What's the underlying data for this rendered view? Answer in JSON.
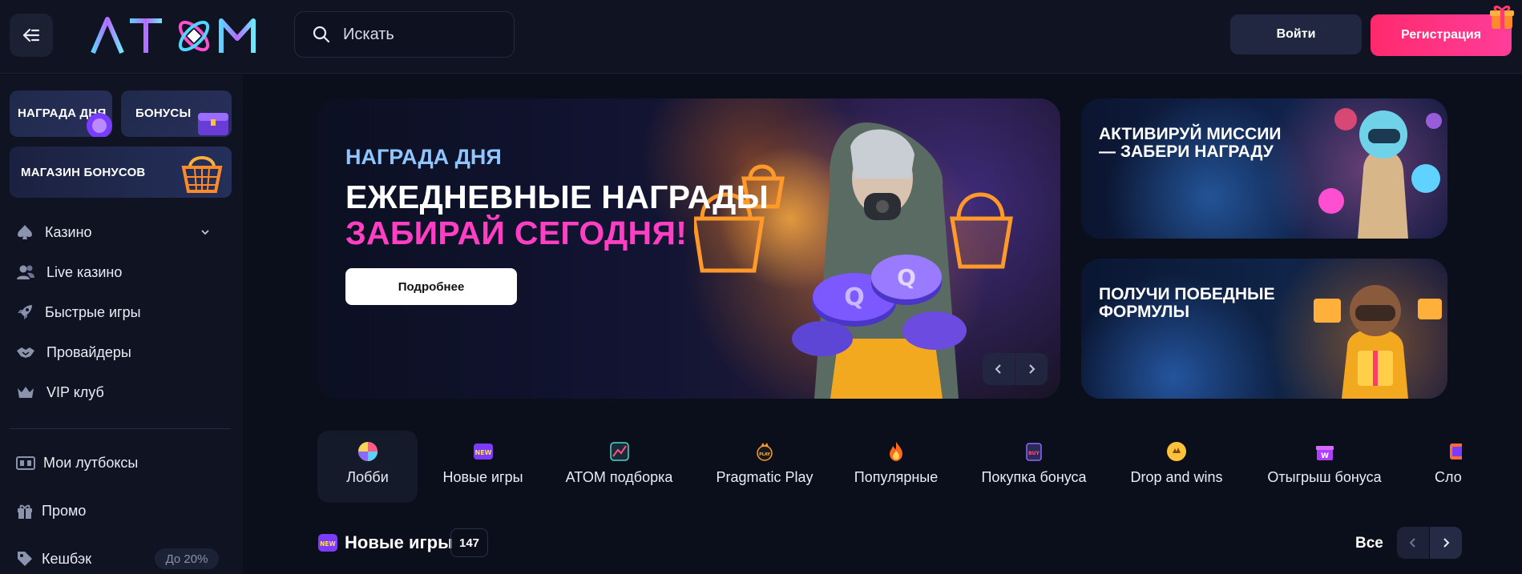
{
  "header": {
    "logo_text": "ATOM",
    "search_placeholder": "Искать",
    "login_label": "Войти",
    "register_label": "Регистрация"
  },
  "sidebar": {
    "promo_tiles": [
      {
        "label": "НАГРАДА ДНЯ"
      },
      {
        "label": "БОНУСЫ"
      },
      {
        "label": "МАГАЗИН БОНУСОВ"
      }
    ],
    "nav": [
      {
        "label": "Казино",
        "icon": "spade-icon"
      },
      {
        "label": "Live казино",
        "icon": "users-icon"
      },
      {
        "label": "Быстрые игры",
        "icon": "rocket-icon"
      },
      {
        "label": "Провайдеры",
        "icon": "handshake-icon"
      },
      {
        "label": "VIP клуб",
        "icon": "crown-icon"
      }
    ],
    "secondary": [
      {
        "label": "Мои лутбоксы",
        "icon": "lootbox-icon"
      },
      {
        "label": "Промо",
        "icon": "gift-icon"
      },
      {
        "label": "Кешбэк",
        "icon": "tag-icon",
        "badge": "До 20%"
      }
    ]
  },
  "hero": {
    "tag": "НАГРАДА ДНЯ",
    "title_line1": "ЕЖЕДНЕВНЫЕ НАГРАДЫ",
    "title_line2": "ЗАБИРАЙ СЕГОДНЯ!",
    "button_label": "Подробнее"
  },
  "side_banners": [
    {
      "line1": "АКТИВИРУЙ МИССИИ",
      "line2": "— ЗАБЕРИ НАГРАДУ"
    },
    {
      "line1": "ПОЛУЧИ ПОБЕДНЫЕ",
      "line2": "ФОРМУЛЫ"
    }
  ],
  "categories": [
    {
      "label": "Лобби",
      "icon": "lobby-icon",
      "active": true
    },
    {
      "label": "Новые игры",
      "icon": "new-badge-icon"
    },
    {
      "label": "ATOM подборка",
      "icon": "atom-pick-icon"
    },
    {
      "label": "Pragmatic Play",
      "icon": "pragmatic-icon"
    },
    {
      "label": "Популярные",
      "icon": "fire-icon"
    },
    {
      "label": "Покупка бонуса",
      "icon": "buy-bonus-icon"
    },
    {
      "label": "Drop and wins",
      "icon": "drop-wins-icon"
    },
    {
      "label": "Отыгрыш бонуса",
      "icon": "wager-bonus-icon"
    },
    {
      "label": "Сло",
      "icon": "slots-icon"
    }
  ],
  "section": {
    "title": "Новые игры",
    "count": "147",
    "all_label": "Все"
  },
  "colors": {
    "background": "#0b0f1c",
    "accent_pink": "#ff3fc3",
    "accent_blue": "#8fc6ff",
    "register": "#ff2a6d"
  }
}
